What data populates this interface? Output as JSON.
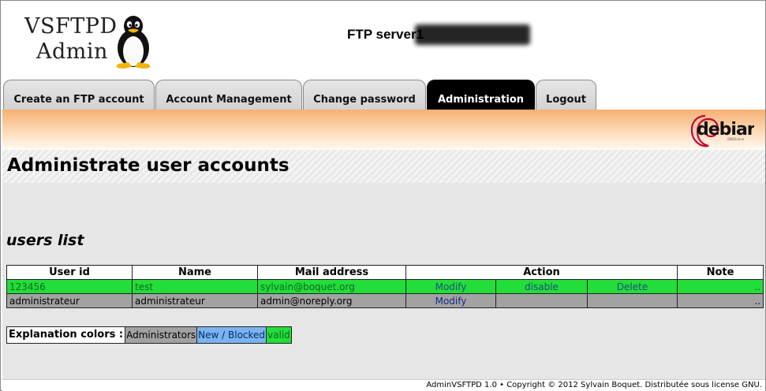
{
  "header": {
    "logo_line1": "VSFTPD",
    "logo_line2": "Admin",
    "server_label": "FTP server",
    "server_ip": "1"
  },
  "tabs": [
    {
      "label": "Create an FTP account",
      "active": false
    },
    {
      "label": "Account Management",
      "active": false
    },
    {
      "label": "Change password",
      "active": false
    },
    {
      "label": "Administration",
      "active": true
    },
    {
      "label": "Logout",
      "active": false
    }
  ],
  "band": {
    "logo_text": "debian"
  },
  "page": {
    "title": "Administrate user accounts"
  },
  "users": {
    "section_title": "users list",
    "columns": [
      "User id",
      "Name",
      "Mail address",
      "Action",
      "Note"
    ],
    "rows": [
      {
        "status": "valid",
        "user_id": "123456",
        "name": "test",
        "mail": "sylvain@boquet.org",
        "action_modify": "Modify",
        "action_toggle": "disable",
        "action_delete": "Delete",
        "note": ".."
      },
      {
        "status": "admin",
        "user_id": "administrateur",
        "name": "administrateur",
        "mail": "admin@noreply.org",
        "action_modify": "Modify",
        "action_toggle": "",
        "action_delete": "",
        "note": ".."
      }
    ]
  },
  "legend": {
    "label": "Explanation colors :",
    "items": [
      "Administrators",
      "New / Blocked",
      "valid"
    ]
  },
  "colors": {
    "valid": "#22dd3a",
    "admin": "#a2a2a2",
    "blocked": "#7ab4f0",
    "active_tab": "#000000",
    "band": "#f6b071"
  },
  "footer": {
    "text": "AdminVSFTPD 1.0 • Copyright © 2012 Sylvain Boquet. Distributée sous license GNU."
  }
}
